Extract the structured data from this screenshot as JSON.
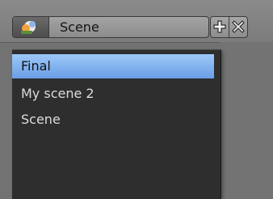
{
  "scene_selector": {
    "icon": "scene-icon",
    "current_value": "Scene",
    "add_icon": "plus-icon",
    "remove_icon": "close-icon"
  },
  "menu": {
    "items": [
      {
        "label": "Final",
        "selected": true
      },
      {
        "label": "My scene 2",
        "selected": false
      },
      {
        "label": "Scene",
        "selected": false
      }
    ]
  },
  "colors": {
    "highlight": "#8ab8f2",
    "menu_background": "#2e2e2e",
    "menu_text": "#dcdcdc"
  }
}
